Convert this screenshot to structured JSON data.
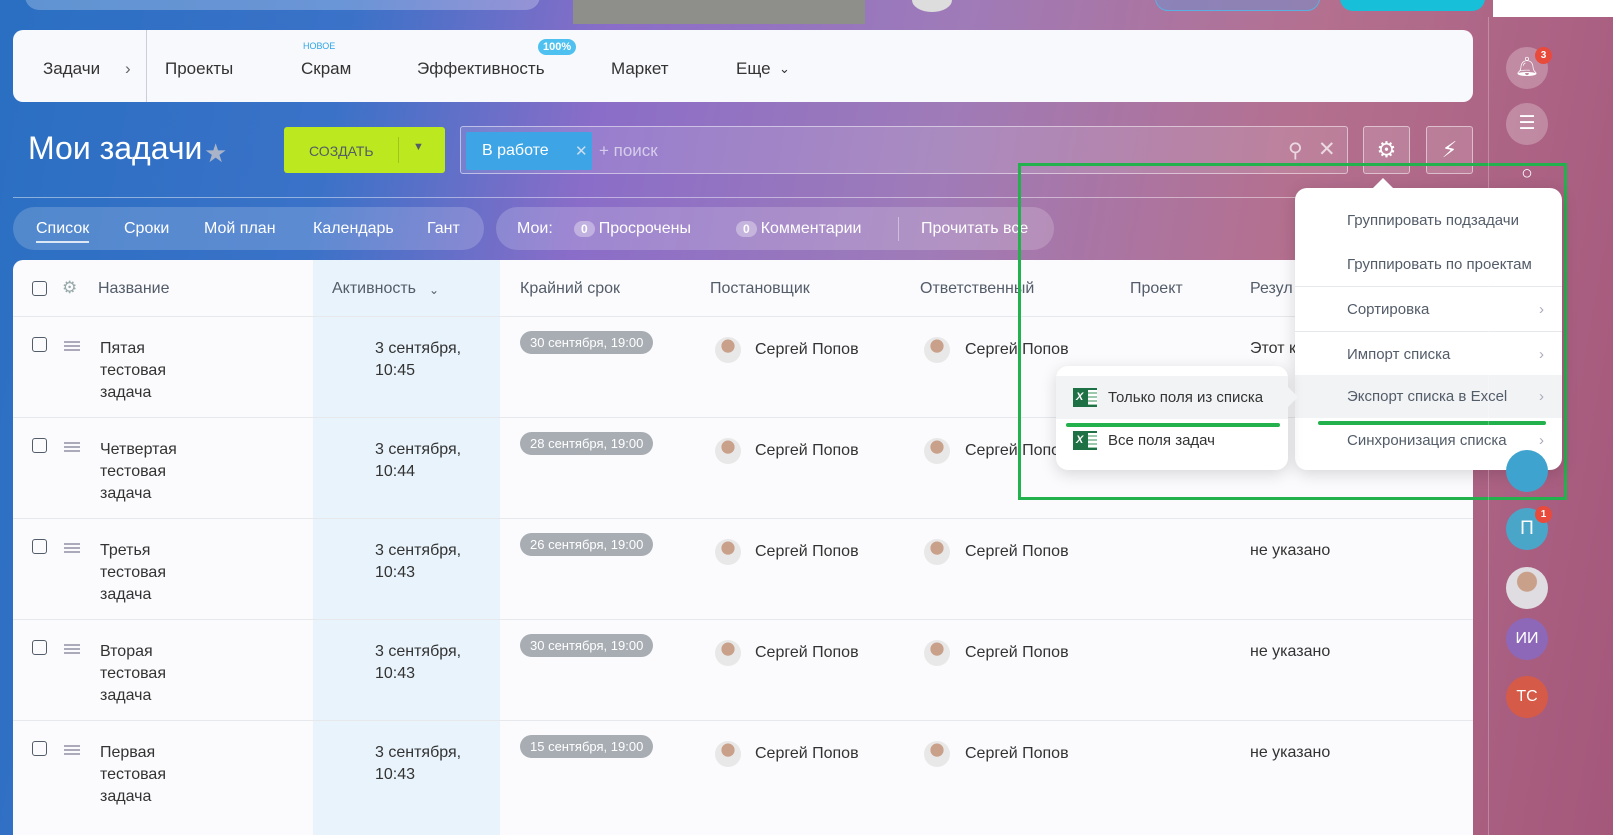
{
  "nav": {
    "tasks": "Задачи",
    "projects": "Проекты",
    "scrum": "Скрам",
    "scrum_badge": "НОВОЕ",
    "efficiency": "Эффективность",
    "efficiency_badge": "100%",
    "market": "Маркет",
    "more": "Еще"
  },
  "page": {
    "title": "Мои задачи",
    "create": "СОЗДАТЬ"
  },
  "search": {
    "tag": "В работе",
    "placeholder": "+ поиск"
  },
  "views": [
    "Список",
    "Сроки",
    "Мой план",
    "Календарь",
    "Гант"
  ],
  "counters": {
    "label": "Мои:",
    "overdue_count": "0",
    "overdue": "Просрочены",
    "comments_count": "0",
    "comments": "Комментарии",
    "read_all": "Прочитать все"
  },
  "table": {
    "headers": {
      "name": "Название",
      "activity": "Активность",
      "deadline": "Крайний срок",
      "creator": "Постановщик",
      "responsible": "Ответственный",
      "project": "Проект",
      "result": "Резул"
    },
    "rows": [
      {
        "name": "Пятая тестовая задача",
        "activity": "3 сентября, 10:45",
        "deadline": "30 сентября, 19:00",
        "creator": "Сергей Попов",
        "responsible": "Сергей Попов",
        "result": "Этот к"
      },
      {
        "name": "Четвертая тестовая задача",
        "activity": "3 сентября, 10:44",
        "deadline": "28 сентября, 19:00",
        "creator": "Сергей Попов",
        "responsible": "Сергей Попов",
        "result": ""
      },
      {
        "name": "Третья тестовая задача",
        "activity": "3 сентября, 10:43",
        "deadline": "26 сентября, 19:00",
        "creator": "Сергей Попов",
        "responsible": "Сергей Попов",
        "result": "не указано"
      },
      {
        "name": "Вторая тестовая задача",
        "activity": "3 сентября, 10:43",
        "deadline": "30 сентября, 19:00",
        "creator": "Сергей Попов",
        "responsible": "Сергей Попов",
        "result": "не указано"
      },
      {
        "name": "Первая тестовая задача",
        "activity": "3 сентября, 10:43",
        "deadline": "15 сентября, 19:00",
        "creator": "Сергей Попов",
        "responsible": "Сергей Попов",
        "result": "не указано"
      }
    ]
  },
  "menu": [
    "Группировать подзадачи",
    "Группировать по проектам",
    "Сортировка",
    "Импорт списка",
    "Экспорт списка в Excel",
    "Синхронизация списка"
  ],
  "submenu": [
    "Только поля из списка",
    "Все поля задач"
  ],
  "sidebar": {
    "notifications_count": "3",
    "p_label": "П",
    "p_count": "1",
    "ii": "ИИ",
    "ts": "ТС"
  },
  "colors": {
    "accent": "#bbe81f",
    "tag": "#3da5e6",
    "highlight": "#22b14c"
  }
}
